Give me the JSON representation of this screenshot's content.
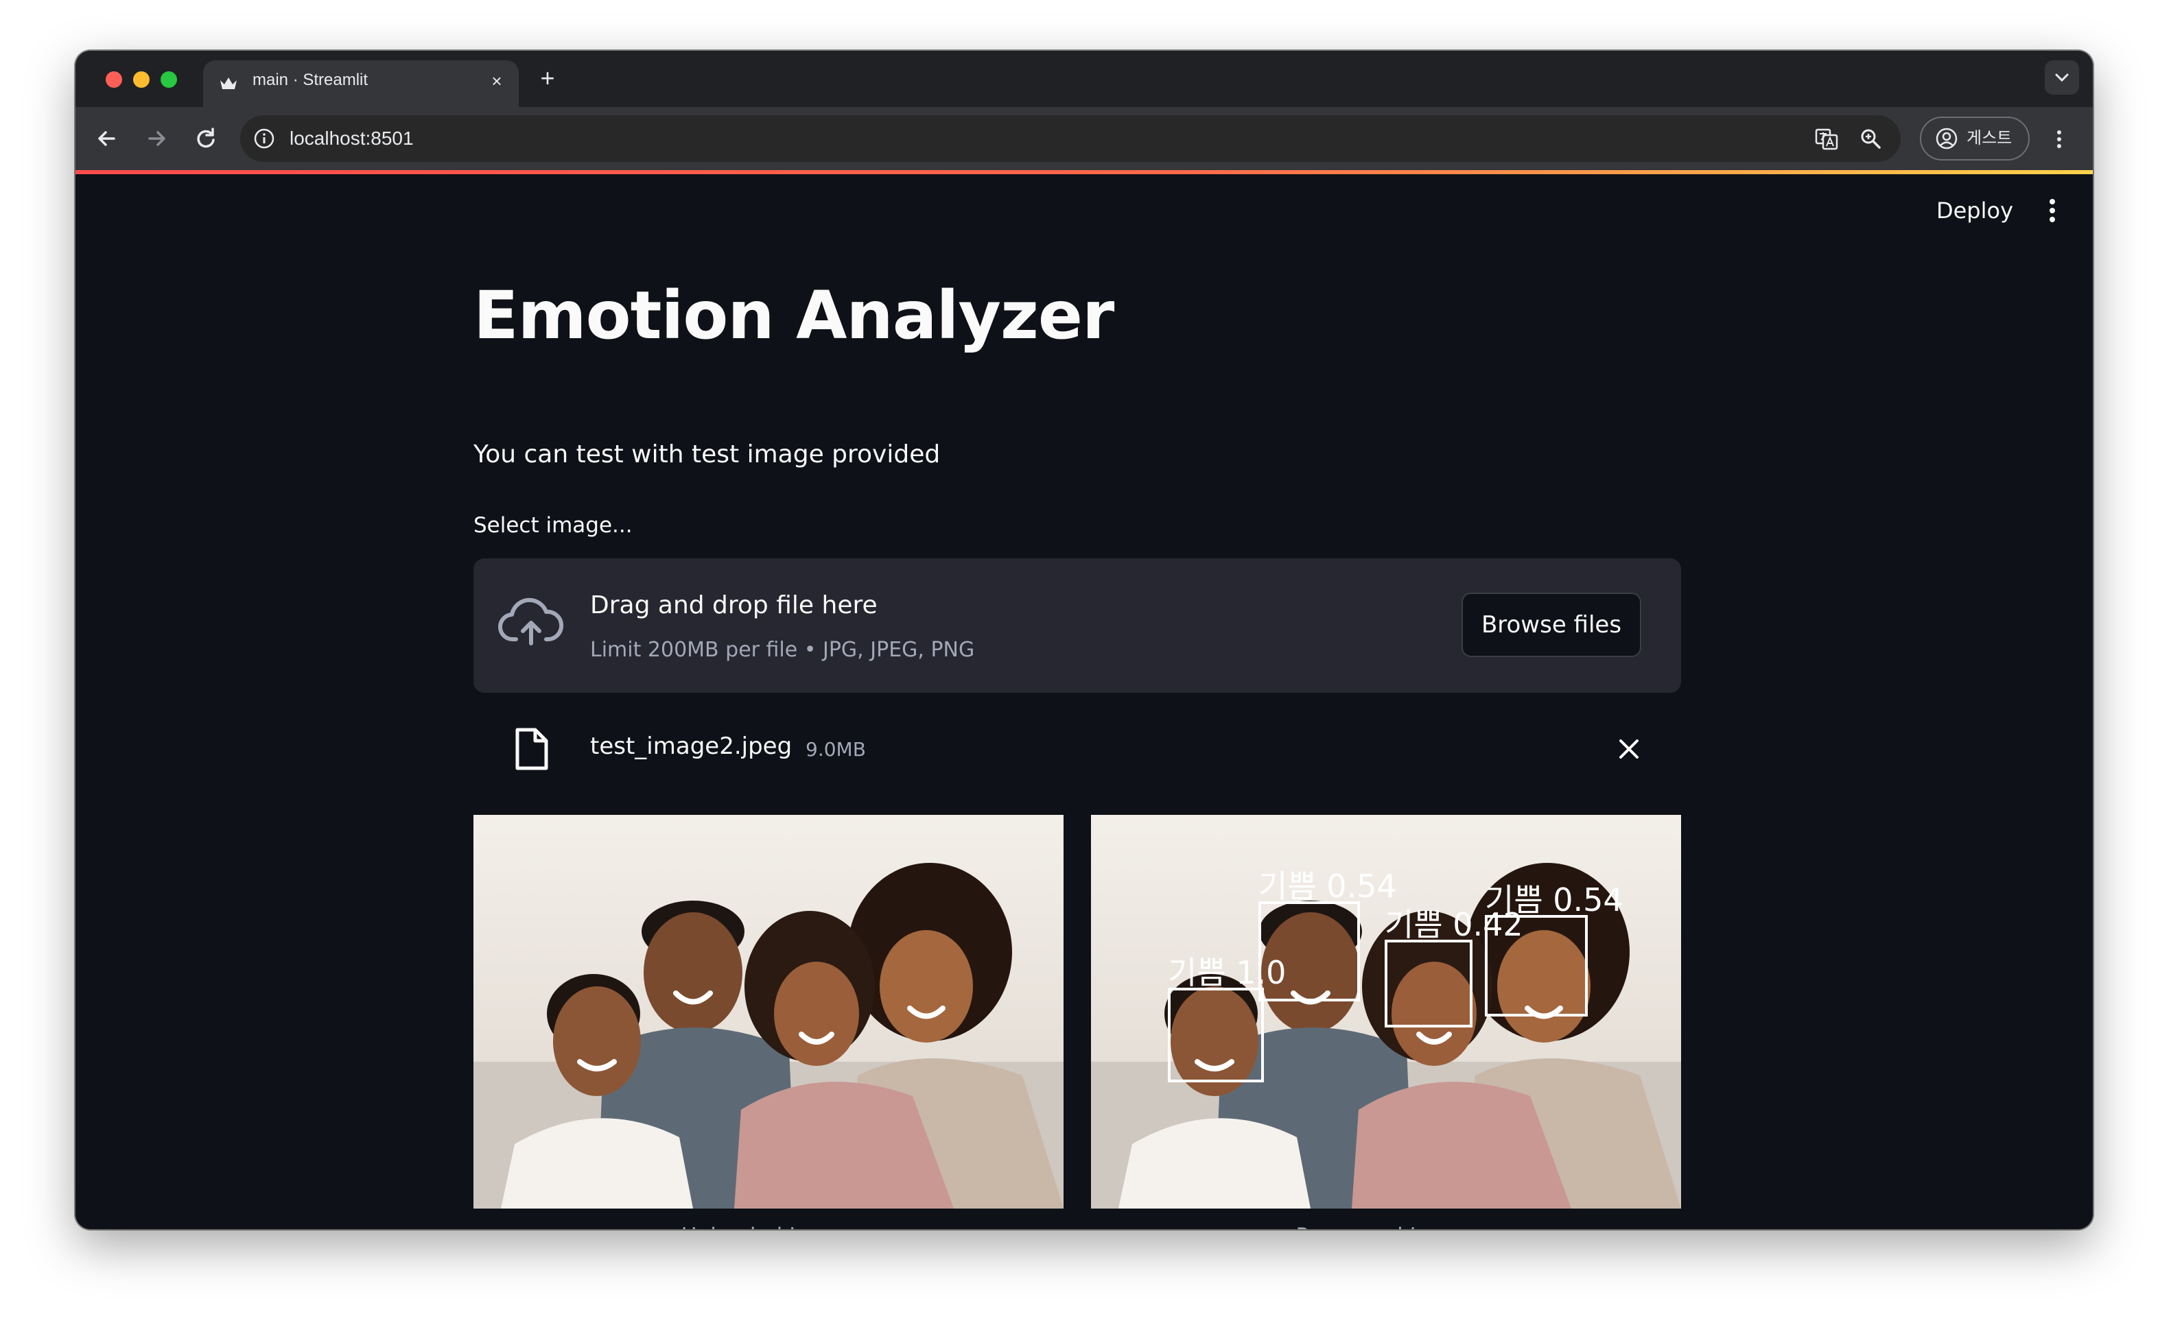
{
  "browser": {
    "tab_title": "main · Streamlit",
    "new_tab_label": "+",
    "tab_close_label": "×",
    "url": "localhost:8501",
    "profile_label": "게스트"
  },
  "app": {
    "deploy_label": "Deploy",
    "title": "Emotion Analyzer",
    "subtitle": "You can test with test image provided",
    "uploader": {
      "label": "Select image...",
      "dropzone_title": "Drag and drop file here",
      "dropzone_limit": "Limit 200MB per file • JPG, JPEG, PNG",
      "browse_label": "Browse files",
      "file": {
        "name": "test_image2.jpeg",
        "size": "9.0MB"
      }
    },
    "images": {
      "uploaded_caption": "Uploaded Image",
      "processed_caption": "Processed Image",
      "detections": [
        {
          "label": "기쁨 1.0"
        },
        {
          "label": "기쁨 0.54"
        },
        {
          "label": "기쁨 0.42"
        },
        {
          "label": "기쁨 0.54"
        }
      ]
    }
  },
  "colors": {
    "app_background": "#0e1117",
    "widget_background": "#262730",
    "text": "#fafafa",
    "muted_text": "#a3a8b8",
    "accent_start": "#ff4b4b",
    "accent_end": "#ffd34b"
  },
  "icons": {
    "upload": "cloud-upload-icon",
    "file": "file-icon",
    "remove": "close-icon",
    "menu": "more-vertical-icon"
  }
}
